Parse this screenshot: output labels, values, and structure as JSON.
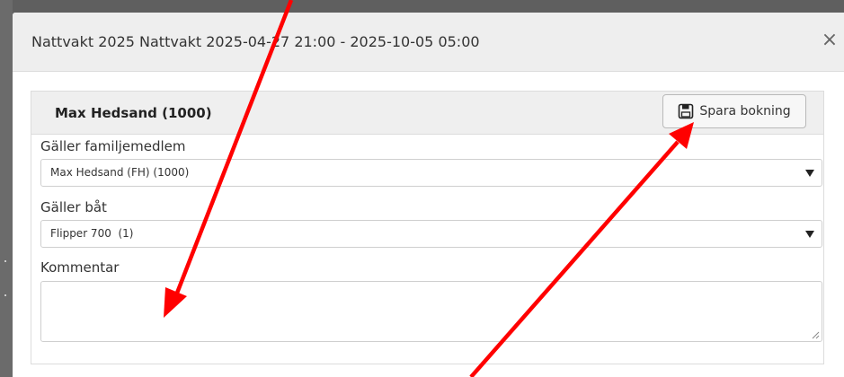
{
  "modal": {
    "title": "Nattvakt 2025 Nattvakt 2025-04-27 21:00 - 2025-10-05 05:00",
    "close_symbol": "×"
  },
  "booking": {
    "member_name": "Max Hedsand (1000)",
    "save_label": "Spara bokning",
    "save_icon": "floppy-disk-icon",
    "family_member_label": "Gäller familjemedlem",
    "family_member_value": "Max Hedsand (FH) (1000)",
    "boat_label": "Gäller båt",
    "boat_value": "Flipper 700  (1)",
    "comment_label": "Kommentar",
    "comment_value": ""
  },
  "annotations": {
    "arrow_color": "#ff0000"
  }
}
